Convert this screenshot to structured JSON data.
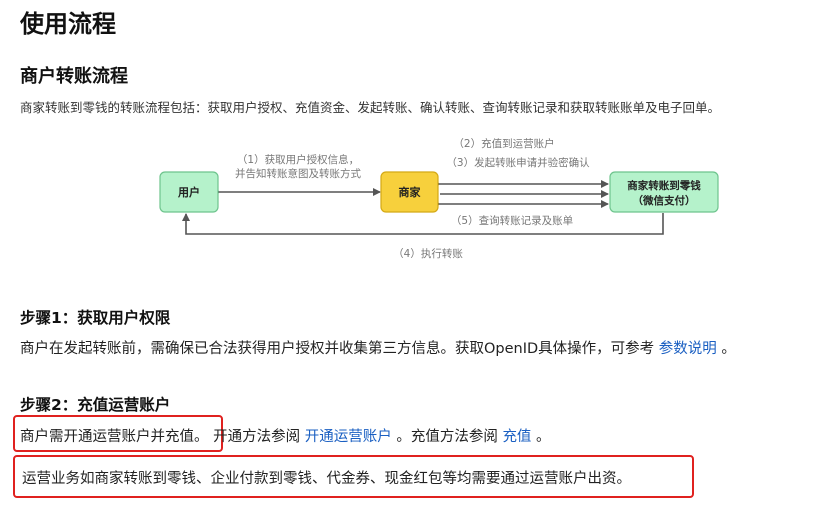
{
  "page": {
    "title": "使用流程",
    "section_title": "商户转账流程",
    "intro": "商家转账到零钱的转账流程包括：获取用户授权、充值资金、发起转账、确认转账、查询转账记录和获取转账账单及电子回单。"
  },
  "diagram": {
    "nodes": {
      "user": "用户",
      "merchant": "商家",
      "wechat_line1": "商家转账到零钱",
      "wechat_line2": "（微信支付）"
    },
    "labels": {
      "step1_line1": "（1）获取用户授权信息，",
      "step1_line2": "并告知转账意图及转账方式",
      "step2": "（2）充值到运营账户",
      "step3": "（3）发起转账申请并验密确认",
      "step5": "（5）查询转账记录及账单",
      "step4": "（4）执行转账"
    },
    "colors": {
      "user_fill": "#b5f2cb",
      "merchant_fill": "#f7d03c",
      "wechat_fill": "#b5f2cb",
      "arrow": "#555555"
    }
  },
  "step1": {
    "heading": "步骤1：获取用户权限",
    "text": "商户在发起转账前，需确保已合法获得用户授权并收集第三方信息。获取OpenID具体操作，可参考",
    "link": "参数说明",
    "end": "。"
  },
  "step2": {
    "heading": "步骤2：充值运营账户",
    "boxed_text": "商户需开通运营账户并充值。",
    "text_a": "开通方法参阅",
    "link_a": "开通运营账户",
    "text_b": "。充值方法参阅",
    "link_b": "充值",
    "end": "。",
    "note": "运营业务如商家转账到零钱、企业付款到零钱、代金券、现金红包等均需要通过运营账户出资。"
  },
  "highlight_color": "#e0211f",
  "link_color": "#1a5fc2"
}
